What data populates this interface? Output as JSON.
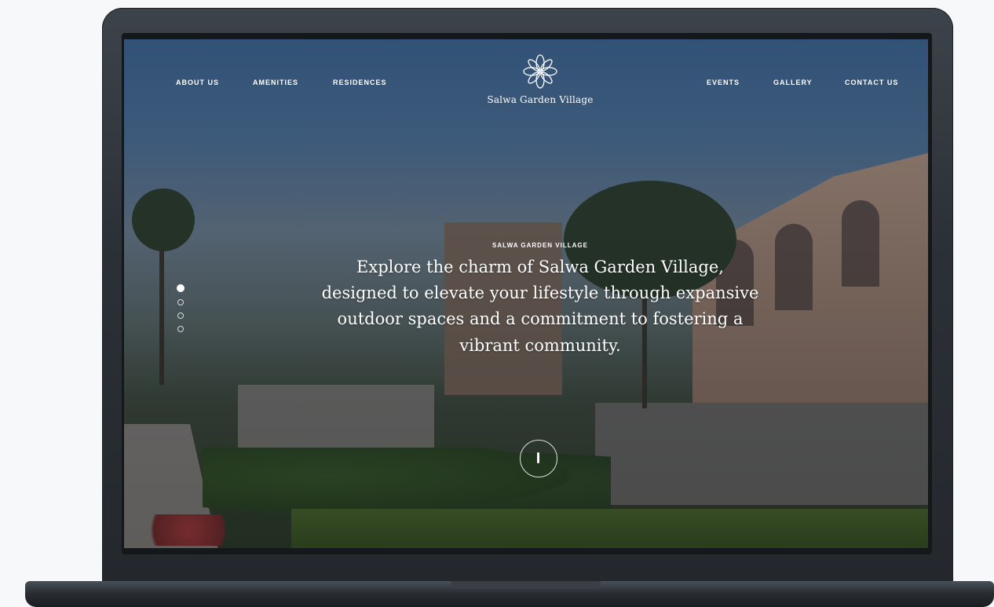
{
  "nav": {
    "left": [
      {
        "label": "ABOUT US"
      },
      {
        "label": "AMENITIES"
      },
      {
        "label": "RESIDENCES"
      }
    ],
    "right": [
      {
        "label": "EVENTS"
      },
      {
        "label": "GALLERY"
      },
      {
        "label": "CONTACT US"
      }
    ]
  },
  "logo": {
    "text": "Salwa Garden Village",
    "icon": "flower-logo-icon"
  },
  "hero": {
    "eyebrow": "SALWA GARDEN VILLAGE",
    "line1": "Explore the charm of Salwa Garden Village,",
    "line2": "designed to elevate your lifestyle through expansive",
    "line3": "outdoor spaces and a commitment to fostering a",
    "line4": "vibrant community."
  },
  "slider": {
    "slide_count": 4,
    "active_slide": 1
  },
  "scroll_button": {
    "icon": "scroll-down-icon"
  },
  "colors": {
    "text": "#ffffff",
    "laptop_frame": "#2c3137"
  }
}
